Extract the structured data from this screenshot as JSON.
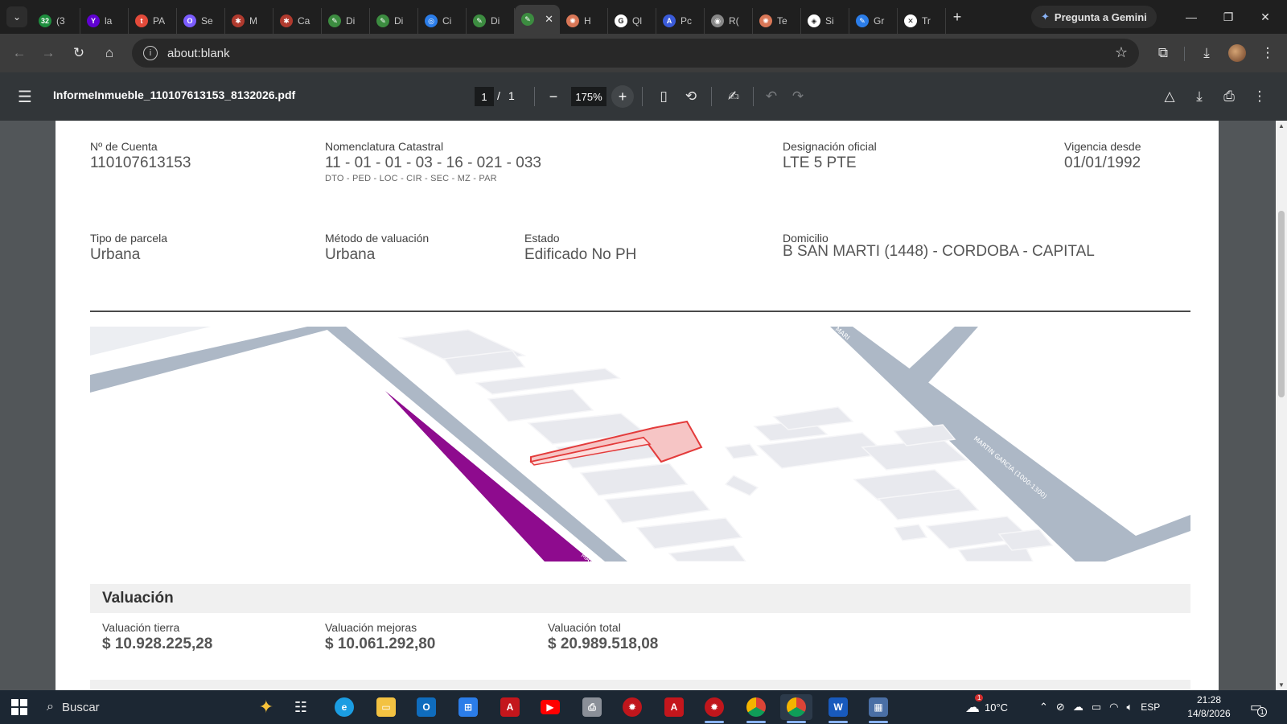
{
  "browser": {
    "tabs": [
      {
        "label": "(3",
        "badge": "32",
        "color": "#1e8e3e",
        "icon": "sheets-icon"
      },
      {
        "label": "la",
        "badge": "Y",
        "color": "#6001d2",
        "icon": "yahoo-icon"
      },
      {
        "label": "PA",
        "badge": "t",
        "color": "#e34a3a",
        "icon": "t-icon"
      },
      {
        "label": "Se",
        "badge": "O",
        "color": "#7b5cff",
        "icon": "ring-icon"
      },
      {
        "label": "M",
        "badge": "✱",
        "color": "#b03a2e",
        "icon": "flower-icon"
      },
      {
        "label": "Ca",
        "badge": "✱",
        "color": "#b03a2e",
        "icon": "flower-icon"
      },
      {
        "label": "Di",
        "badge": "✎",
        "color": "#3c8c40",
        "icon": "leaf-icon"
      },
      {
        "label": "Di",
        "badge": "✎",
        "color": "#3c8c40",
        "icon": "leaf-icon"
      },
      {
        "label": "Ci",
        "badge": "◎",
        "color": "#2b7de9",
        "icon": "copilot-icon"
      },
      {
        "label": "Di",
        "badge": "✎",
        "color": "#3c8c40",
        "icon": "leaf-icon"
      },
      {
        "label": "",
        "badge": "✎",
        "color": "#3c8c40",
        "icon": "leaf-icon",
        "active": true
      },
      {
        "label": "H",
        "badge": "✺",
        "color": "#d97757",
        "icon": "claude-icon"
      },
      {
        "label": "Ql",
        "badge": "G",
        "color": "#ffffff",
        "icon": "google-icon"
      },
      {
        "label": "Pc",
        "badge": "A",
        "color": "#3a5bd9",
        "icon": "a-icon"
      },
      {
        "label": "R(",
        "badge": "◉",
        "color": "#888888",
        "icon": "globe-icon"
      },
      {
        "label": "Te",
        "badge": "✺",
        "color": "#d97757",
        "icon": "claude-icon"
      },
      {
        "label": "Si",
        "badge": "◈",
        "color": "#ffffff",
        "icon": "openai-icon"
      },
      {
        "label": "Gr",
        "badge": "✎",
        "color": "#2b7de9",
        "icon": "pen-icon"
      },
      {
        "label": "Tr",
        "badge": "✕",
        "color": "#ffffff",
        "icon": "x-icon"
      }
    ],
    "gemini_label": "Pregunta a Gemini",
    "address": "about:blank"
  },
  "pdf": {
    "filename": "InformeInmueble_110107613153_8132026.pdf",
    "page_current": "1",
    "page_sep": "/",
    "page_total": "1",
    "zoom": "175%"
  },
  "report": {
    "cuenta_label": "Nº de Cuenta",
    "cuenta_value": "110107613153",
    "nomenclatura_label": "Nomenclatura Catastral",
    "nomenclatura_value": "11 - 01 - 01 - 03 - 16 - 021 - 033",
    "nomenclatura_sub": "DTO - PED - LOC - CIR - SEC - MZ - PAR",
    "designacion_label": "Designación oficial",
    "designacion_value": "LTE 5 PTE",
    "vigencia_label": "Vigencia desde",
    "vigencia_value": "01/01/1992",
    "tipo_label": "Tipo de parcela",
    "tipo_value": "Urbana",
    "metodo_label": "Método de valuación",
    "metodo_value": "Urbana",
    "estado_label": "Estado",
    "estado_value": "Edificado No PH",
    "domicilio_label": "Domicilio",
    "domicilio_value": "B SAN MARTI (1448) - CORDOBA - CAPITAL",
    "map_street_1": "MANUEL",
    "map_street_2": "MARTIN GARCIA (1000-1300)",
    "map_street_3": "MARI"
  },
  "valuacion": {
    "title": "Valuación",
    "tierra_label": "Valuación tierra",
    "tierra_value": "$ 10.928.225,28",
    "mejoras_label": "Valuación mejoras",
    "mejoras_value": "$ 10.061.292,80",
    "total_label": "Valuación total",
    "total_value": "$ 20.989.518,08"
  },
  "taskbar": {
    "search_label": "Buscar",
    "weather": "10°C",
    "weather_badge": "1",
    "lang": "ESP",
    "time": "21:28",
    "date": "14/8/2026",
    "notif_count": "1"
  }
}
